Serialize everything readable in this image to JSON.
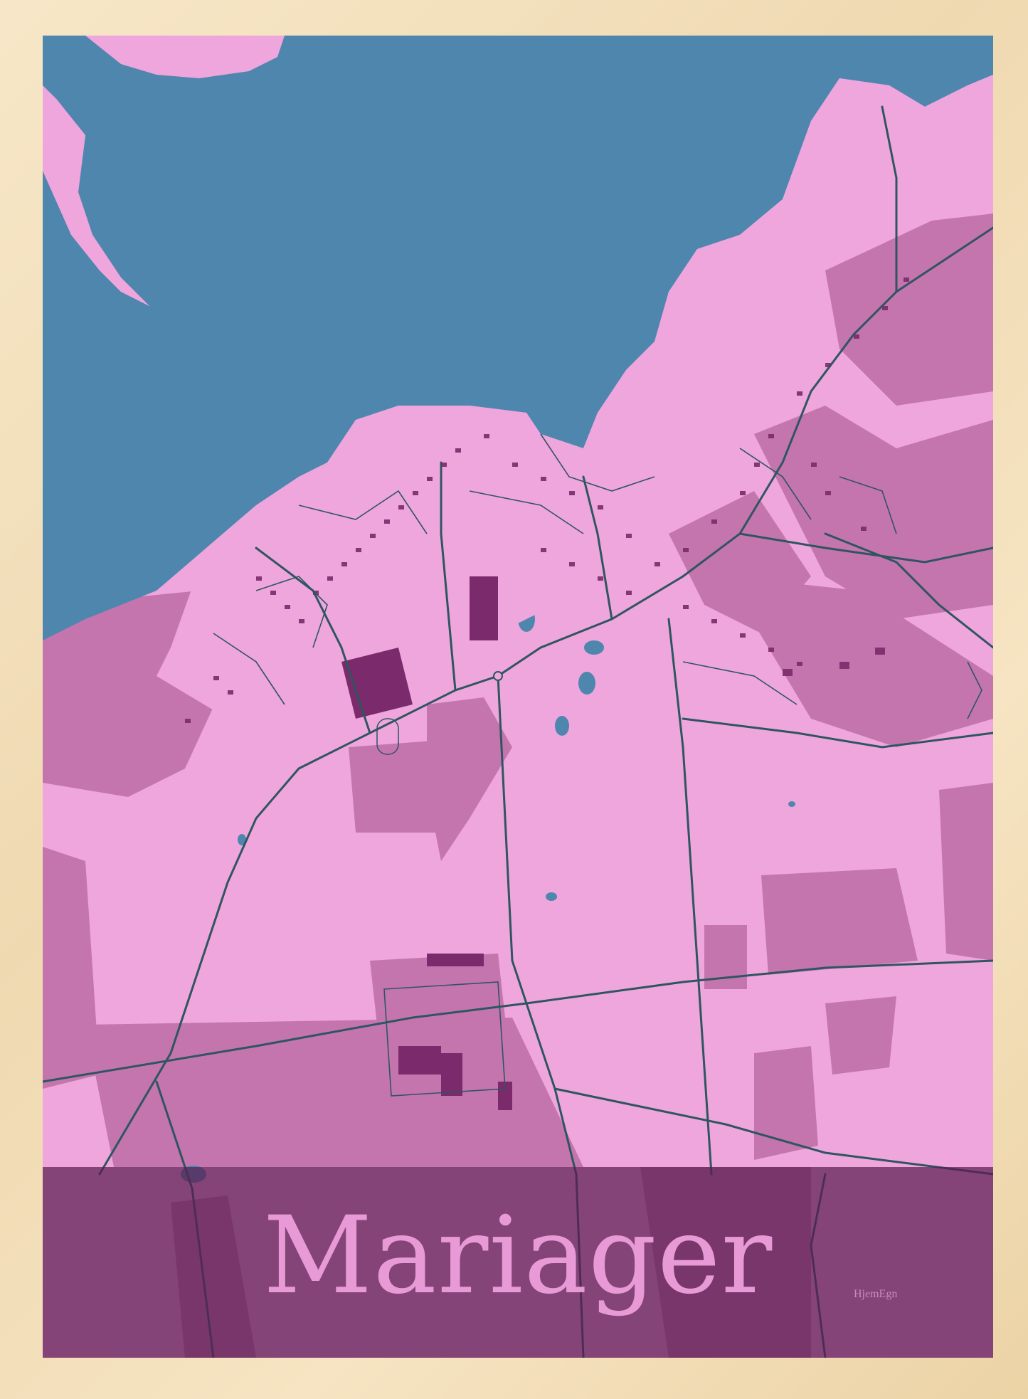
{
  "poster": {
    "title": "Mariager",
    "brand": "HjemEgn"
  },
  "colors": {
    "water": "#4f86ae",
    "land": "#efa6dc",
    "field": "#c475ae",
    "building": "#7b2a6b",
    "road": "#2f5560",
    "band": "#5a1e50",
    "title_text": "#e79ad6",
    "frame": "#f2dfbb"
  }
}
